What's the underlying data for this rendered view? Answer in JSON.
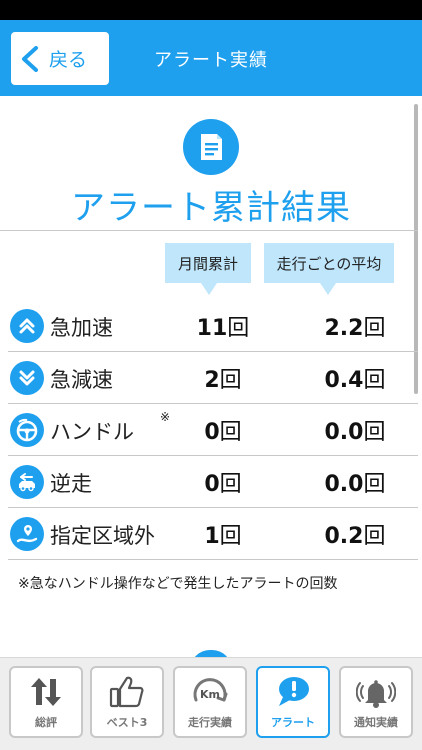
{
  "header": {
    "back_label": "戻る",
    "title": "アラート実績"
  },
  "summary": {
    "title": "アラート累計結果",
    "col_monthly": "月間累計",
    "col_average": "走行ごとの平均",
    "rows": [
      {
        "label": "急加速",
        "monthly_num": "11",
        "monthly_unit": "回",
        "average_num": "2.2",
        "average_unit": "回",
        "icon": "double-chevron-up-icon"
      },
      {
        "label": "急減速",
        "monthly_num": "2",
        "monthly_unit": "回",
        "average_num": "0.4",
        "average_unit": "回",
        "icon": "double-chevron-down-icon"
      },
      {
        "label": "ハンドル",
        "note": "※",
        "monthly_num": "0",
        "monthly_unit": "回",
        "average_num": "0.0",
        "average_unit": "回",
        "icon": "steering-wheel-icon"
      },
      {
        "label": "逆走",
        "monthly_num": "0",
        "monthly_unit": "回",
        "average_num": "0.0",
        "average_unit": "回",
        "icon": "wrong-way-car-icon"
      },
      {
        "label": "指定区域外",
        "monthly_num": "1",
        "monthly_unit": "回",
        "average_num": "0.2",
        "average_unit": "回",
        "icon": "area-pin-icon"
      }
    ],
    "footnote": "※急なハンドル操作などで発生したアラートの回数"
  },
  "tabs": [
    {
      "label": "総評",
      "icon": "up-down-arrows-icon"
    },
    {
      "label": "ベスト3",
      "icon": "thumbs-up-icon"
    },
    {
      "label": "走行実績",
      "icon": "km-gauge-icon"
    },
    {
      "label": "アラート",
      "icon": "alert-bubble-icon",
      "active": true
    },
    {
      "label": "通知実績",
      "icon": "bell-icon"
    }
  ],
  "colors": {
    "accent": "#1ea0ee",
    "column_header_bg": "#bfe6fb"
  }
}
